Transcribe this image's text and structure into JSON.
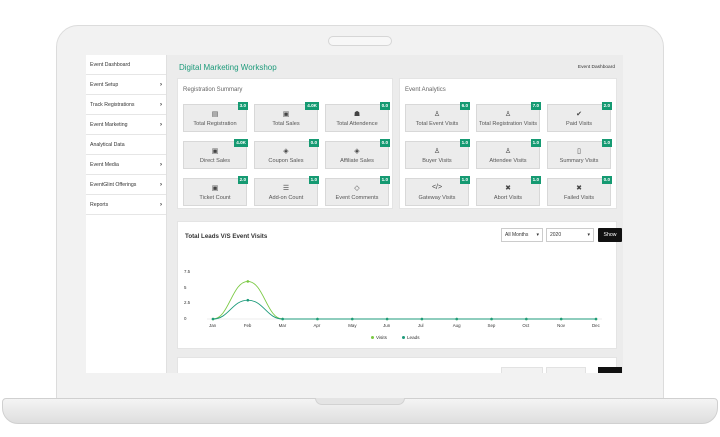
{
  "sidebar": {
    "items": [
      {
        "label": "Event Dashboard",
        "chevron": false
      },
      {
        "label": "Event Setup",
        "chevron": true
      },
      {
        "label": "Track Registrations",
        "chevron": true
      },
      {
        "label": "Event Marketing",
        "chevron": true
      },
      {
        "label": "Analytical Data",
        "chevron": false
      },
      {
        "label": "Event Media",
        "chevron": true
      },
      {
        "label": "EventGlint Offerings",
        "chevron": true
      },
      {
        "label": "Reports",
        "chevron": true
      }
    ]
  },
  "header": {
    "title": "Digital Marketing Workshop",
    "breadcrumb": "Event Dashboard"
  },
  "registration_summary": {
    "title": "Registration Summary",
    "tiles": [
      {
        "label": "Total Registration",
        "value": "3.0",
        "icon": "id-card-icon",
        "glyph": "▤"
      },
      {
        "label": "Total Sales",
        "value": "4.0K",
        "icon": "cash-icon",
        "glyph": "▣"
      },
      {
        "label": "Total Attendence",
        "value": "0.0",
        "icon": "users-icon",
        "glyph": "☗"
      },
      {
        "label": "Direct Sales",
        "value": "4.0K",
        "icon": "cash-icon",
        "glyph": "▣"
      },
      {
        "label": "Coupon Sales",
        "value": "0.0",
        "icon": "tag-icon",
        "glyph": "◈"
      },
      {
        "label": "Affiliate Sales",
        "value": "0.0",
        "icon": "tag-icon",
        "glyph": "◈"
      },
      {
        "label": "Ticket Count",
        "value": "2.0",
        "icon": "ticket-icon",
        "glyph": "▣"
      },
      {
        "label": "Add-on Count",
        "value": "1.0",
        "icon": "list-icon",
        "glyph": "☰"
      },
      {
        "label": "Event Comments",
        "value": "1.0",
        "icon": "comment-icon",
        "glyph": "◇"
      }
    ]
  },
  "event_analytics": {
    "title": "Event Analytics",
    "tiles": [
      {
        "label": "Total Event Visits",
        "value": "6.0",
        "icon": "user-icon",
        "glyph": "♙"
      },
      {
        "label": "Total Registration Visits",
        "value": "7.0",
        "icon": "user-icon",
        "glyph": "♙"
      },
      {
        "label": "Paid Visits",
        "value": "2.0",
        "icon": "check-icon",
        "glyph": "✔"
      },
      {
        "label": "Buyer Visits",
        "value": "1.0",
        "icon": "user-icon",
        "glyph": "♙"
      },
      {
        "label": "Attendee Visits",
        "value": "1.0",
        "icon": "user-icon",
        "glyph": "♙"
      },
      {
        "label": "Summary Visits",
        "value": "1.0",
        "icon": "document-icon",
        "glyph": "▯"
      },
      {
        "label": "Gateway Visits",
        "value": "1.0",
        "icon": "code-icon",
        "glyph": "</>"
      },
      {
        "label": "Abort Visits",
        "value": "1.0",
        "icon": "close-icon",
        "glyph": "✖"
      },
      {
        "label": "Failed Visits",
        "value": "0.0",
        "icon": "close-icon",
        "glyph": "✖"
      }
    ]
  },
  "chart_controls": {
    "months": "All Months",
    "year": "2020",
    "show_label": "Show"
  },
  "chart_data": {
    "type": "line",
    "title": "Total Leads V/S Event Visits",
    "x": [
      "Jan",
      "Feb",
      "Mar",
      "Apr",
      "May",
      "Jun",
      "Jul",
      "Aug",
      "Sep",
      "Oct",
      "Nov",
      "Dec"
    ],
    "y_ticks": [
      "7.5",
      "5",
      "2.5",
      "0"
    ],
    "ylim": [
      0,
      7.5
    ],
    "series": [
      {
        "name": "Visits",
        "values": [
          0,
          6,
          0,
          0,
          0,
          0,
          0,
          0,
          0,
          0,
          0,
          0
        ],
        "color": "#7ac943"
      },
      {
        "name": "Leads",
        "values": [
          0,
          3,
          0,
          0,
          0,
          0,
          0,
          0,
          0,
          0,
          0,
          0
        ],
        "color": "#1e9b7b"
      }
    ],
    "legend_position": "bottom"
  }
}
